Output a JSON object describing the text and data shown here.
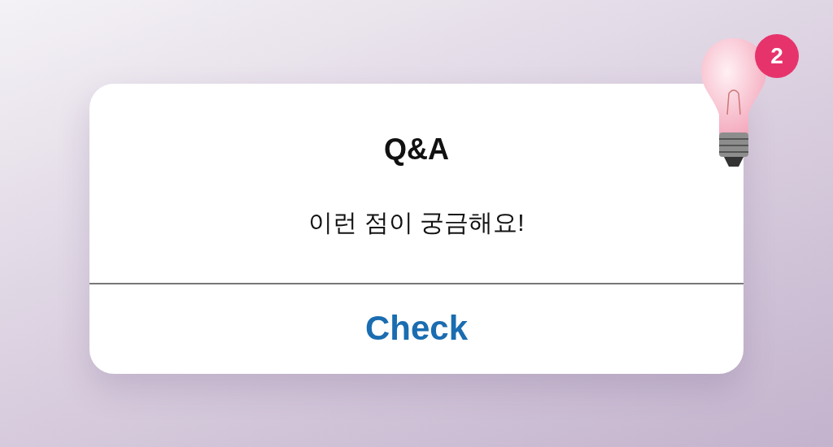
{
  "dialog": {
    "title": "Q&A",
    "message": "이런 점이 궁금해요!",
    "button": "Check",
    "badge": "2"
  }
}
